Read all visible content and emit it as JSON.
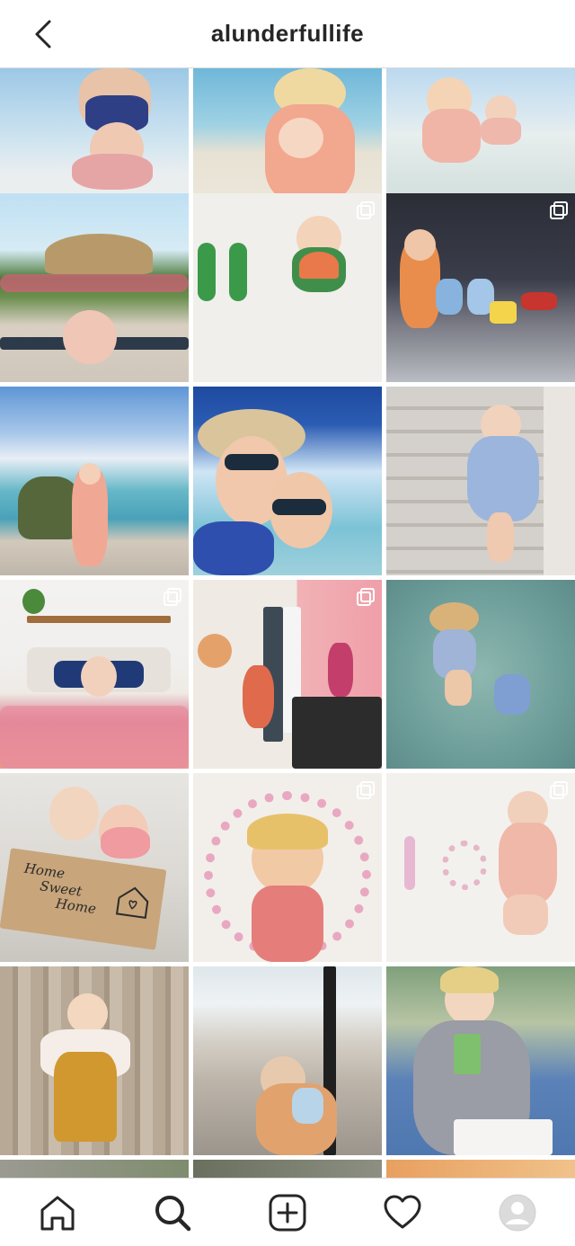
{
  "header": {
    "title": "alunderfullife",
    "back_icon": "chevron-left-icon"
  },
  "grid": {
    "rows": 6,
    "columns": 3,
    "tiles": [
      {
        "desc": "beach mom and baby",
        "multi": false
      },
      {
        "desc": "toddler in pink swim shirt on beach",
        "multi": false
      },
      {
        "desc": "two kids in shallow water",
        "multi": false
      },
      {
        "desc": "palm trees and tiki hut poolside",
        "multi": false
      },
      {
        "desc": "baby with rainbow outfit and number",
        "multi": true
      },
      {
        "desc": "family sitting in car trunk",
        "multi": true
      },
      {
        "desc": "toddler on beach rocks",
        "multi": false
      },
      {
        "desc": "couple selfie on boat",
        "multi": false
      },
      {
        "desc": "baby standing by stone wall",
        "multi": false
      },
      {
        "desc": "baby on bed with pink quilt",
        "multi": true
      },
      {
        "desc": "toddler in flamingo wallpaper room",
        "multi": true
      },
      {
        "desc": "mom and toddler wading in water",
        "multi": false
      },
      {
        "desc": "two kids in moving box",
        "multi": false
      },
      {
        "desc": "girl with candy heart rainbow",
        "multi": true
      },
      {
        "desc": "baby with candy heart number",
        "multi": true
      },
      {
        "desc": "toddler in mustard dress by tree",
        "multi": false
      },
      {
        "desc": "mom holding baby on street",
        "multi": false
      },
      {
        "desc": "toddler drinking juice box",
        "multi": false
      }
    ],
    "box_text": [
      "Home",
      "Sweet",
      "Home"
    ]
  },
  "nav": {
    "home_icon": "home-icon",
    "search_icon": "search-icon",
    "add_icon": "add-post-icon",
    "activity_icon": "heart-icon",
    "profile_icon": "profile-avatar-icon"
  },
  "colors": {
    "header_text": "#262626",
    "divider": "#dbdbdb",
    "background": "#ffffff"
  }
}
